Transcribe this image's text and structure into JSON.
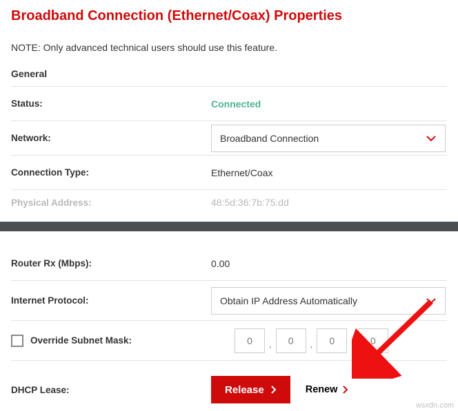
{
  "title": "Broadband Connection (Ethernet/Coax) Properties",
  "note": "NOTE: Only advanced technical users should use this feature.",
  "section_general": "General",
  "status": {
    "label": "Status:",
    "value": "Connected"
  },
  "network": {
    "label": "Network:",
    "selected": "Broadband Connection"
  },
  "connection_type": {
    "label": "Connection Type:",
    "value": "Ethernet/Coax"
  },
  "physical_address": {
    "label": "Physical Address:",
    "value": "48:5d:36:7b:75:dd"
  },
  "router_rx": {
    "label": "Router Rx (Mbps):",
    "value": "0.00"
  },
  "internet_protocol": {
    "label": "Internet Protocol:",
    "selected": "Obtain IP Address Automatically"
  },
  "override_subnet": {
    "label": "Override Subnet Mask:",
    "octets": [
      "0",
      "0",
      "0",
      "0"
    ]
  },
  "dhcp_lease": {
    "label": "DHCP Lease:",
    "release": "Release",
    "renew": "Renew"
  },
  "watermark": "wsxdn.com"
}
